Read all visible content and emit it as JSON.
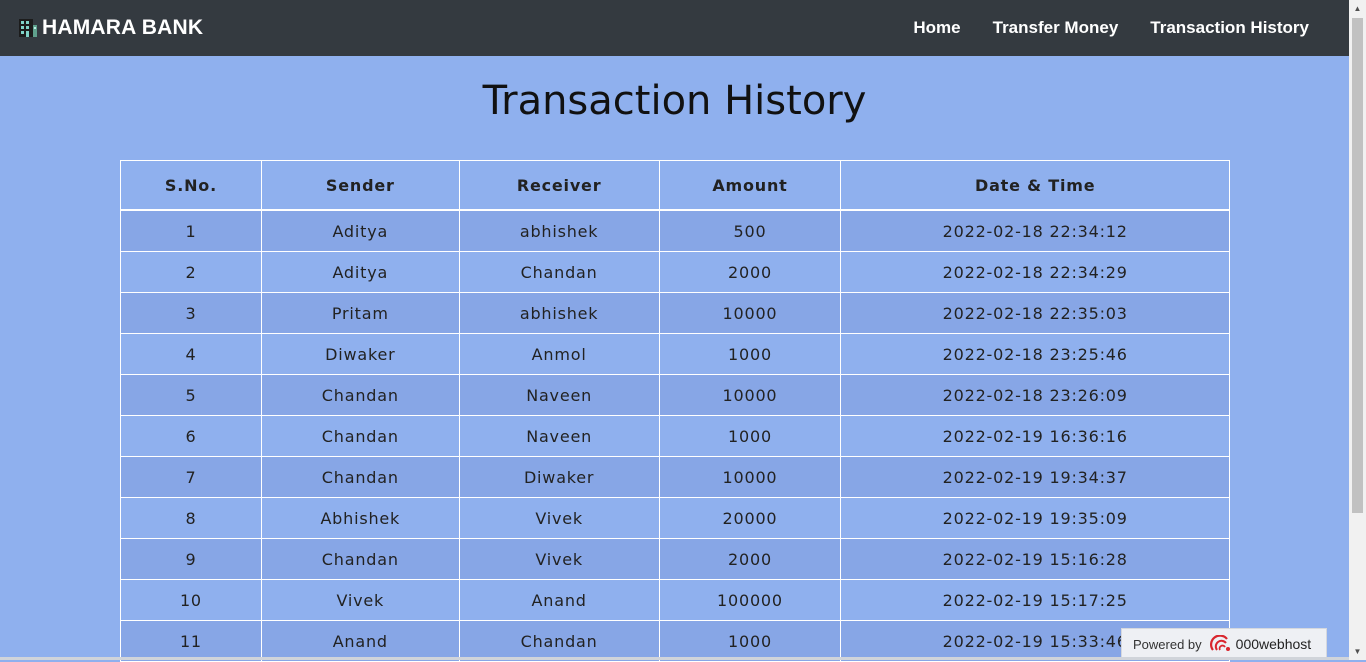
{
  "brand": {
    "name": "HAMARA BANK",
    "icon": "bank-building-icon"
  },
  "nav": {
    "items": [
      {
        "label": "Home"
      },
      {
        "label": "Transfer Money"
      },
      {
        "label": "Transaction History"
      }
    ]
  },
  "page": {
    "title": "Transaction History"
  },
  "table": {
    "headers": [
      "S.No.",
      "Sender",
      "Receiver",
      "Amount",
      "Date & Time"
    ],
    "rows": [
      [
        "1",
        "Aditya",
        "abhishek",
        "500",
        "2022-02-18 22:34:12"
      ],
      [
        "2",
        "Aditya",
        "Chandan",
        "2000",
        "2022-02-18 22:34:29"
      ],
      [
        "3",
        "Pritam",
        "abhishek",
        "10000",
        "2022-02-18 22:35:03"
      ],
      [
        "4",
        "Diwaker",
        "Anmol",
        "1000",
        "2022-02-18 23:25:46"
      ],
      [
        "5",
        "Chandan",
        "Naveen",
        "10000",
        "2022-02-18 23:26:09"
      ],
      [
        "6",
        "Chandan",
        "Naveen",
        "1000",
        "2022-02-19 16:36:16"
      ],
      [
        "7",
        "Chandan",
        "Diwaker",
        "10000",
        "2022-02-19 19:34:37"
      ],
      [
        "8",
        "Abhishek",
        "Vivek",
        "20000",
        "2022-02-19 19:35:09"
      ],
      [
        "9",
        "Chandan",
        "Vivek",
        "2000",
        "2022-02-19 15:16:28"
      ],
      [
        "10",
        "Vivek",
        "Anand",
        "100000",
        "2022-02-19 15:17:25"
      ],
      [
        "11",
        "Anand",
        "Chandan",
        "1000",
        "2022-02-19 15:33:46"
      ]
    ]
  },
  "badge": {
    "powered_label": "Powered by",
    "host": "000webhost",
    "icon": "000webhost-logo-icon"
  },
  "colors": {
    "navbar": "#343a40",
    "page_bg": "#8fb0ee",
    "row_alt": "#87a6e6"
  }
}
